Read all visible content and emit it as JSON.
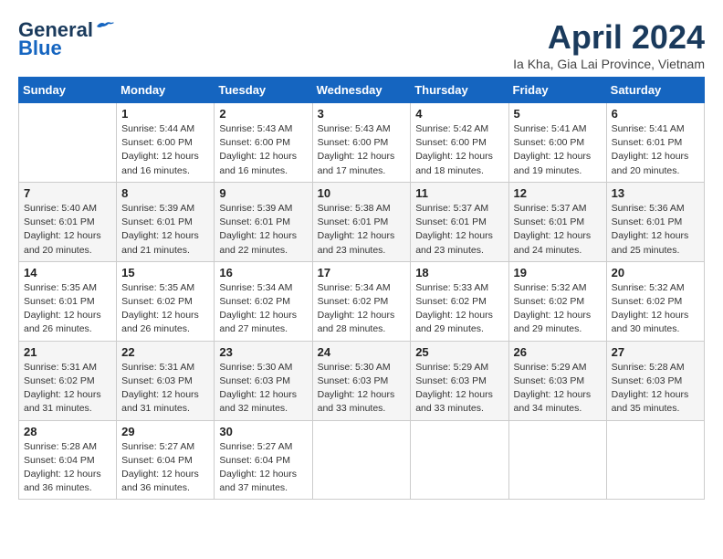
{
  "header": {
    "logo_line1": "General",
    "logo_line2": "Blue",
    "month_title": "April 2024",
    "subtitle": "Ia Kha, Gia Lai Province, Vietnam"
  },
  "weekdays": [
    "Sunday",
    "Monday",
    "Tuesday",
    "Wednesday",
    "Thursday",
    "Friday",
    "Saturday"
  ],
  "weeks": [
    [
      {
        "day": "",
        "info": ""
      },
      {
        "day": "1",
        "info": "Sunrise: 5:44 AM\nSunset: 6:00 PM\nDaylight: 12 hours\nand 16 minutes."
      },
      {
        "day": "2",
        "info": "Sunrise: 5:43 AM\nSunset: 6:00 PM\nDaylight: 12 hours\nand 16 minutes."
      },
      {
        "day": "3",
        "info": "Sunrise: 5:43 AM\nSunset: 6:00 PM\nDaylight: 12 hours\nand 17 minutes."
      },
      {
        "day": "4",
        "info": "Sunrise: 5:42 AM\nSunset: 6:00 PM\nDaylight: 12 hours\nand 18 minutes."
      },
      {
        "day": "5",
        "info": "Sunrise: 5:41 AM\nSunset: 6:00 PM\nDaylight: 12 hours\nand 19 minutes."
      },
      {
        "day": "6",
        "info": "Sunrise: 5:41 AM\nSunset: 6:01 PM\nDaylight: 12 hours\nand 20 minutes."
      }
    ],
    [
      {
        "day": "7",
        "info": "Sunrise: 5:40 AM\nSunset: 6:01 PM\nDaylight: 12 hours\nand 20 minutes."
      },
      {
        "day": "8",
        "info": "Sunrise: 5:39 AM\nSunset: 6:01 PM\nDaylight: 12 hours\nand 21 minutes."
      },
      {
        "day": "9",
        "info": "Sunrise: 5:39 AM\nSunset: 6:01 PM\nDaylight: 12 hours\nand 22 minutes."
      },
      {
        "day": "10",
        "info": "Sunrise: 5:38 AM\nSunset: 6:01 PM\nDaylight: 12 hours\nand 23 minutes."
      },
      {
        "day": "11",
        "info": "Sunrise: 5:37 AM\nSunset: 6:01 PM\nDaylight: 12 hours\nand 23 minutes."
      },
      {
        "day": "12",
        "info": "Sunrise: 5:37 AM\nSunset: 6:01 PM\nDaylight: 12 hours\nand 24 minutes."
      },
      {
        "day": "13",
        "info": "Sunrise: 5:36 AM\nSunset: 6:01 PM\nDaylight: 12 hours\nand 25 minutes."
      }
    ],
    [
      {
        "day": "14",
        "info": "Sunrise: 5:35 AM\nSunset: 6:01 PM\nDaylight: 12 hours\nand 26 minutes."
      },
      {
        "day": "15",
        "info": "Sunrise: 5:35 AM\nSunset: 6:02 PM\nDaylight: 12 hours\nand 26 minutes."
      },
      {
        "day": "16",
        "info": "Sunrise: 5:34 AM\nSunset: 6:02 PM\nDaylight: 12 hours\nand 27 minutes."
      },
      {
        "day": "17",
        "info": "Sunrise: 5:34 AM\nSunset: 6:02 PM\nDaylight: 12 hours\nand 28 minutes."
      },
      {
        "day": "18",
        "info": "Sunrise: 5:33 AM\nSunset: 6:02 PM\nDaylight: 12 hours\nand 29 minutes."
      },
      {
        "day": "19",
        "info": "Sunrise: 5:32 AM\nSunset: 6:02 PM\nDaylight: 12 hours\nand 29 minutes."
      },
      {
        "day": "20",
        "info": "Sunrise: 5:32 AM\nSunset: 6:02 PM\nDaylight: 12 hours\nand 30 minutes."
      }
    ],
    [
      {
        "day": "21",
        "info": "Sunrise: 5:31 AM\nSunset: 6:02 PM\nDaylight: 12 hours\nand 31 minutes."
      },
      {
        "day": "22",
        "info": "Sunrise: 5:31 AM\nSunset: 6:03 PM\nDaylight: 12 hours\nand 31 minutes."
      },
      {
        "day": "23",
        "info": "Sunrise: 5:30 AM\nSunset: 6:03 PM\nDaylight: 12 hours\nand 32 minutes."
      },
      {
        "day": "24",
        "info": "Sunrise: 5:30 AM\nSunset: 6:03 PM\nDaylight: 12 hours\nand 33 minutes."
      },
      {
        "day": "25",
        "info": "Sunrise: 5:29 AM\nSunset: 6:03 PM\nDaylight: 12 hours\nand 33 minutes."
      },
      {
        "day": "26",
        "info": "Sunrise: 5:29 AM\nSunset: 6:03 PM\nDaylight: 12 hours\nand 34 minutes."
      },
      {
        "day": "27",
        "info": "Sunrise: 5:28 AM\nSunset: 6:03 PM\nDaylight: 12 hours\nand 35 minutes."
      }
    ],
    [
      {
        "day": "28",
        "info": "Sunrise: 5:28 AM\nSunset: 6:04 PM\nDaylight: 12 hours\nand 36 minutes."
      },
      {
        "day": "29",
        "info": "Sunrise: 5:27 AM\nSunset: 6:04 PM\nDaylight: 12 hours\nand 36 minutes."
      },
      {
        "day": "30",
        "info": "Sunrise: 5:27 AM\nSunset: 6:04 PM\nDaylight: 12 hours\nand 37 minutes."
      },
      {
        "day": "",
        "info": ""
      },
      {
        "day": "",
        "info": ""
      },
      {
        "day": "",
        "info": ""
      },
      {
        "day": "",
        "info": ""
      }
    ]
  ]
}
